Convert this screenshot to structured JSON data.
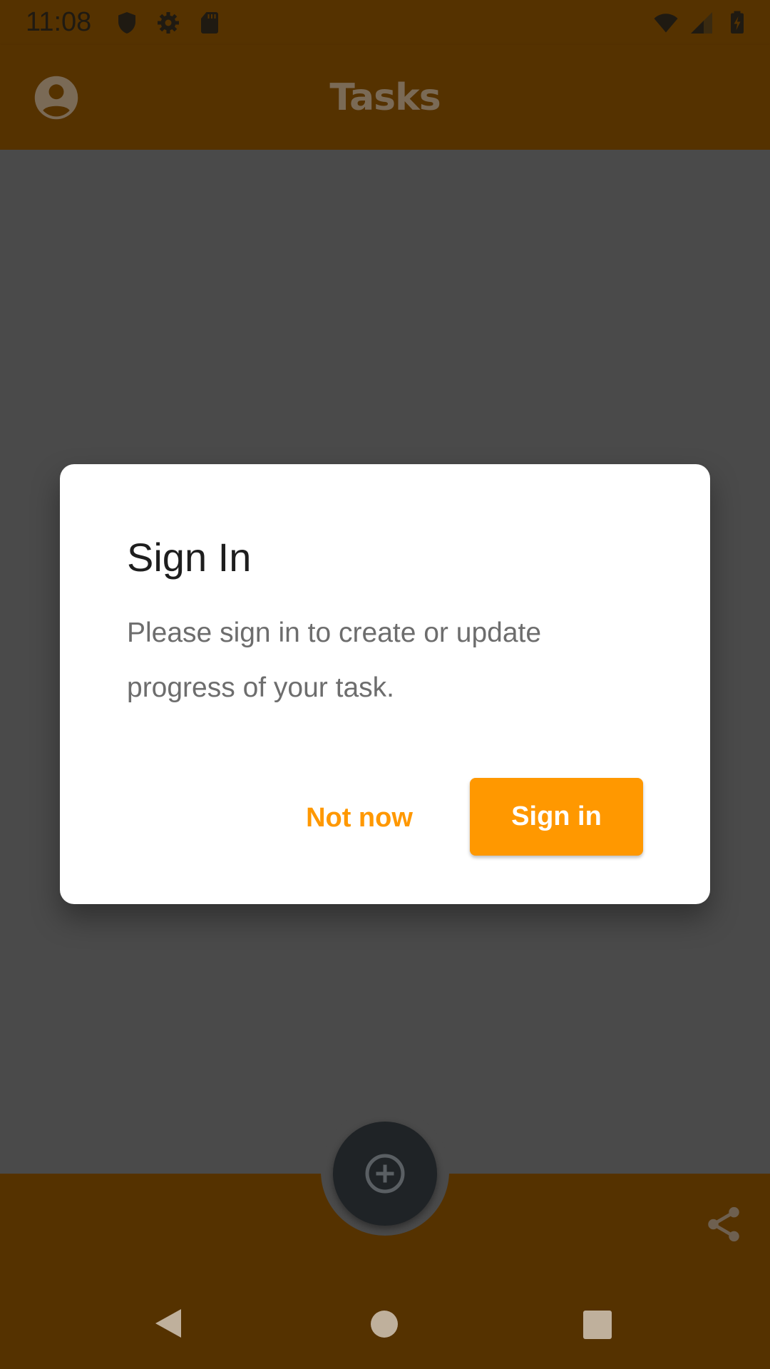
{
  "status_bar": {
    "time": "11:08",
    "left_icons": [
      "shield-icon",
      "gear-icon",
      "sd-card-icon"
    ],
    "right_icons": [
      "wifi-icon",
      "cell-signal-icon",
      "battery-charging-icon"
    ]
  },
  "app_bar": {
    "title": "Tasks",
    "account_icon": "account-circle-icon"
  },
  "dialog": {
    "title": "Sign In",
    "message": "Please sign in to create or update progress of your task.",
    "secondary_button": "Not now",
    "primary_button": "Sign in"
  },
  "bottom_bar": {
    "fab_icon": "add-circle-icon",
    "share_icon": "share-icon"
  },
  "navigation_bar": {
    "buttons": [
      "back",
      "home",
      "recents"
    ]
  },
  "colors": {
    "app_bar": "#553200",
    "scrim_background": "#4a4a4a",
    "accent": "#ff9800",
    "fab": "#1f2326"
  }
}
